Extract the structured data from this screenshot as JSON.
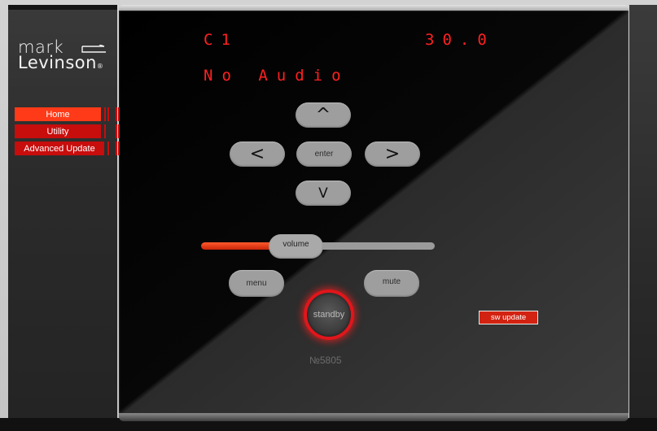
{
  "brand": {
    "line1": "mark",
    "line2": "Levinson",
    "registered": "®"
  },
  "nav": {
    "items": [
      {
        "label": "Home",
        "active": true
      },
      {
        "label": "Utility",
        "active": false
      },
      {
        "label": "Advanced Update",
        "active": false
      }
    ]
  },
  "display": {
    "channel": "C1",
    "level": "30.0",
    "status": "No Audio",
    "text_color": "#ff2020"
  },
  "controls": {
    "up_icon": "chevron-up-icon",
    "down_icon": "chevron-down-icon",
    "left_icon": "chevron-left-icon",
    "right_icon": "chevron-right-icon",
    "up_glyph": "^",
    "down_glyph": "V",
    "left_glyph": "<",
    "right_glyph": ">",
    "enter_label": "enter",
    "volume_label": "volume",
    "volume_level_fraction": 0.32,
    "menu_label": "menu",
    "mute_label": "mute",
    "standby_label": "standby",
    "serial": "№5805",
    "sw_update_label": "sw update"
  },
  "colors": {
    "accent_red": "#c80d0d",
    "active_red": "#ff3a18",
    "glow_red": "#e0161b"
  }
}
